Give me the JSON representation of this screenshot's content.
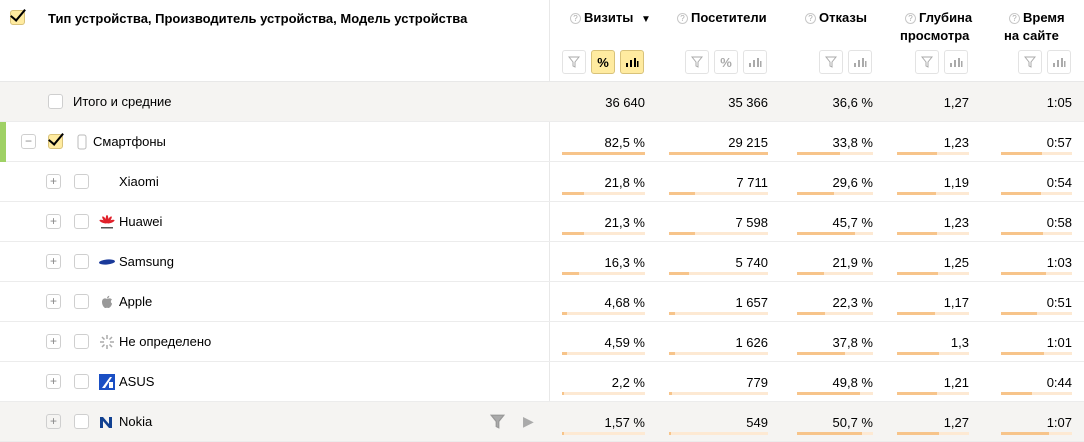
{
  "dimension_header": "Тип устройства, Производитель устройства, Модель устройства",
  "metrics": [
    {
      "key": "visits",
      "line1": "Визиты",
      "line2": "",
      "sort": "▼",
      "buttons": [
        "filter",
        "percent",
        "chart"
      ],
      "active": [
        "percent",
        "chart"
      ]
    },
    {
      "key": "visitors",
      "line1": "Посетители",
      "line2": "",
      "buttons": [
        "filter",
        "percent",
        "chart"
      ],
      "active": []
    },
    {
      "key": "bounces",
      "line1": "Отказы",
      "line2": "",
      "buttons": [
        "filter",
        "chart"
      ],
      "active": []
    },
    {
      "key": "depth",
      "line1": "Глубина",
      "line2": "просмотра",
      "buttons": [
        "filter",
        "chart"
      ],
      "active": []
    },
    {
      "key": "time",
      "line1": "Время",
      "line2": "на сайте",
      "buttons": [
        "filter",
        "chart"
      ],
      "active": []
    }
  ],
  "total": {
    "label": "Итого и средние",
    "values": [
      "36 640",
      "35 366",
      "36,6 %",
      "1,27",
      "1:05"
    ]
  },
  "rows": [
    {
      "label": "Смартфоны",
      "icon": "smartphone-icon",
      "level": 0,
      "checked": true,
      "expanded": true,
      "values": [
        "82,5 %",
        "29 215",
        "33,8 %",
        "1,23",
        "0:57"
      ],
      "bars": [
        1,
        1,
        0.56,
        0.55,
        0.58
      ]
    },
    {
      "label": "Xiaomi",
      "icon": "",
      "level": 1,
      "values": [
        "21,8 %",
        "7 711",
        "29,6 %",
        "1,19",
        "0:54"
      ],
      "bars": [
        0.26,
        0.26,
        0.49,
        0.54,
        0.56
      ]
    },
    {
      "label": "Huawei",
      "icon": "huawei-logo-icon",
      "level": 1,
      "values": [
        "21,3 %",
        "7 598",
        "45,7 %",
        "1,23",
        "0:58"
      ],
      "bars": [
        0.26,
        0.26,
        0.76,
        0.56,
        0.59
      ]
    },
    {
      "label": "Samsung",
      "icon": "samsung-logo-icon",
      "level": 1,
      "values": [
        "16,3 %",
        "5 740",
        "21,9 %",
        "1,25",
        "1:03"
      ],
      "bars": [
        0.2,
        0.2,
        0.36,
        0.57,
        0.63
      ]
    },
    {
      "label": "Apple",
      "icon": "apple-logo-icon",
      "level": 1,
      "values": [
        "4,68 %",
        "1 657",
        "22,3 %",
        "1,17",
        "0:51"
      ],
      "bars": [
        0.06,
        0.06,
        0.37,
        0.53,
        0.51
      ]
    },
    {
      "label": "Не определено",
      "icon": "unknown-icon",
      "level": 1,
      "values": [
        "4,59 %",
        "1 626",
        "37,8 %",
        "1,3",
        "1:01"
      ],
      "bars": [
        0.06,
        0.06,
        0.63,
        0.59,
        0.61
      ]
    },
    {
      "label": "ASUS",
      "icon": "asus-logo-icon",
      "level": 1,
      "values": [
        "2,2 %",
        "779",
        "49,8 %",
        "1,21",
        "0:44"
      ],
      "bars": [
        0.03,
        0.03,
        0.83,
        0.55,
        0.44
      ]
    },
    {
      "label": "Nokia",
      "icon": "nokia-logo-icon",
      "level": 1,
      "hover": true,
      "values": [
        "1,57 %",
        "549",
        "50,7 %",
        "1,27",
        "1:07"
      ],
      "bars": [
        0.02,
        0.02,
        0.85,
        0.58,
        0.67
      ]
    }
  ]
}
